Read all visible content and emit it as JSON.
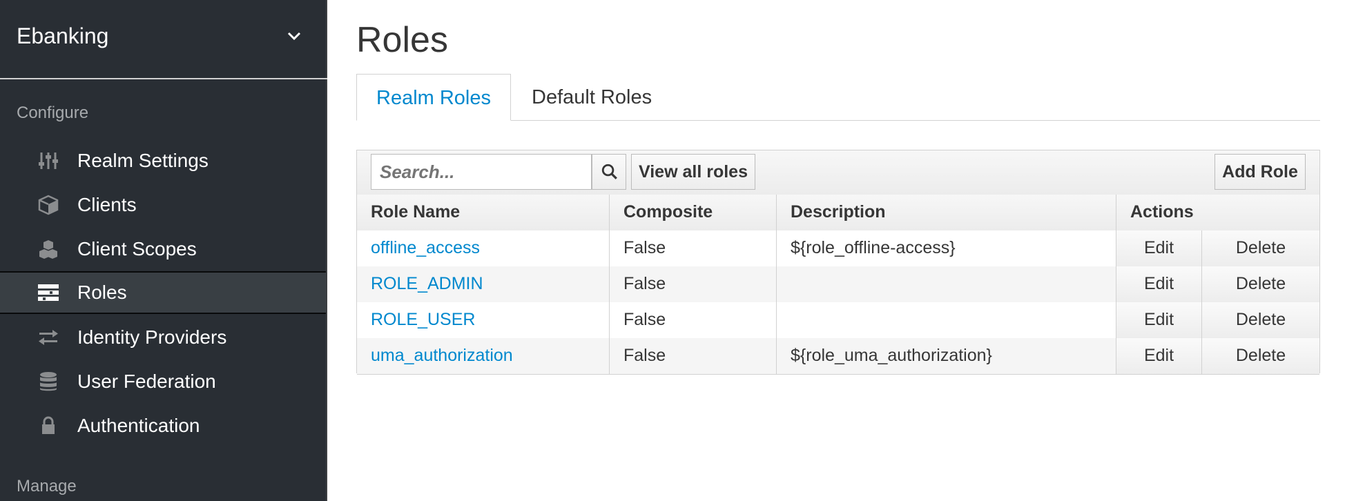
{
  "sidebar": {
    "realm_name": "Ebanking",
    "configure_label": "Configure",
    "manage_label": "Manage",
    "items": [
      {
        "label": "Realm Settings",
        "icon": "sliders-icon"
      },
      {
        "label": "Clients",
        "icon": "cube-icon"
      },
      {
        "label": "Client Scopes",
        "icon": "cubes-icon"
      },
      {
        "label": "Roles",
        "icon": "list-icon",
        "active": true
      },
      {
        "label": "Identity Providers",
        "icon": "exchange-icon"
      },
      {
        "label": "User Federation",
        "icon": "database-icon"
      },
      {
        "label": "Authentication",
        "icon": "lock-icon"
      }
    ]
  },
  "main": {
    "title": "Roles",
    "tabs": [
      {
        "label": "Realm Roles",
        "active": true
      },
      {
        "label": "Default Roles",
        "active": false
      }
    ],
    "search": {
      "placeholder": "Search..."
    },
    "view_all_label": "View all roles",
    "add_role_label": "Add Role",
    "table": {
      "headers": [
        "Role Name",
        "Composite",
        "Description",
        "Actions"
      ],
      "rows": [
        {
          "name": "offline_access",
          "composite": "False",
          "description": "${role_offline-access}",
          "edit": "Edit",
          "delete": "Delete"
        },
        {
          "name": "ROLE_ADMIN",
          "composite": "False",
          "description": "",
          "edit": "Edit",
          "delete": "Delete"
        },
        {
          "name": "ROLE_USER",
          "composite": "False",
          "description": "",
          "edit": "Edit",
          "delete": "Delete"
        },
        {
          "name": "uma_authorization",
          "composite": "False",
          "description": "${role_uma_authorization}",
          "edit": "Edit",
          "delete": "Delete"
        }
      ]
    }
  },
  "colors": {
    "sidebar_bg": "#292e34",
    "link": "#0088ce",
    "active_item_bg": "#393f44"
  }
}
